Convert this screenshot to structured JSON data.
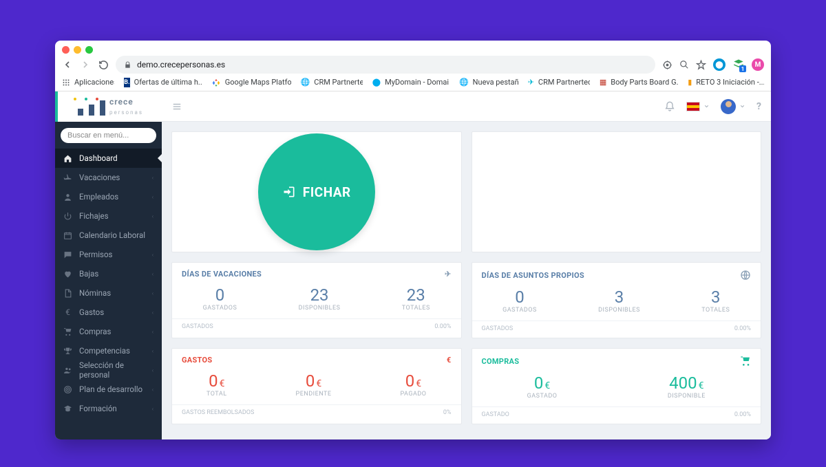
{
  "browser": {
    "url": "demo.crecepersonas.es",
    "bookmarks": [
      "Aplicaciones",
      "Ofertas de última h...",
      "Google Maps Platfo...",
      "CRM Partnertec",
      "MyDomain - Domai...",
      "Nueva pestaña",
      "CRM Partnertec",
      "Body Parts Board G...",
      "RETO 3 Iniciación -..."
    ],
    "avatar_initial": "M"
  },
  "logo": {
    "name_a": "crece",
    "name_b": "personas"
  },
  "sidebar": {
    "search_placeholder": "Buscar en menú...",
    "items": [
      {
        "label": "Dashboard",
        "icon": "home",
        "active": true,
        "chev": false
      },
      {
        "label": "Vacaciones",
        "icon": "plane",
        "active": false,
        "chev": true
      },
      {
        "label": "Empleados",
        "icon": "user",
        "active": false,
        "chev": true
      },
      {
        "label": "Fichajes",
        "icon": "power",
        "active": false,
        "chev": true
      },
      {
        "label": "Calendario Laboral",
        "icon": "calendar",
        "active": false,
        "chev": false
      },
      {
        "label": "Permisos",
        "icon": "chat",
        "active": false,
        "chev": true
      },
      {
        "label": "Bajas",
        "icon": "heart",
        "active": false,
        "chev": true
      },
      {
        "label": "Nóminas",
        "icon": "doc",
        "active": false,
        "chev": true
      },
      {
        "label": "Gastos",
        "icon": "euro",
        "active": false,
        "chev": true
      },
      {
        "label": "Compras",
        "icon": "cart",
        "active": false,
        "chev": true
      },
      {
        "label": "Competencias",
        "icon": "trophy",
        "active": false,
        "chev": true
      },
      {
        "label": "Selección de personal",
        "icon": "users",
        "active": false,
        "chev": true
      },
      {
        "label": "Plan de desarrollo",
        "icon": "target",
        "active": false,
        "chev": true
      },
      {
        "label": "Formación",
        "icon": "grad",
        "active": false,
        "chev": true
      }
    ]
  },
  "fichar_label": "FICHAR",
  "cards": {
    "vac": {
      "title": "DÍAS DE VACACIONES",
      "stats": [
        {
          "num": "0",
          "lbl": "GASTADOS"
        },
        {
          "num": "23",
          "lbl": "DISPONIBLES"
        },
        {
          "num": "23",
          "lbl": "TOTALES"
        }
      ],
      "foot_l": "GASTADOS",
      "foot_r": "0.00%"
    },
    "asuntos": {
      "title": "DÍAS DE ASUNTOS PROPIOS",
      "stats": [
        {
          "num": "0",
          "lbl": "GASTADOS"
        },
        {
          "num": "3",
          "lbl": "DISPONIBLES"
        },
        {
          "num": "3",
          "lbl": "TOTALES"
        }
      ],
      "foot_l": "GASTADOS",
      "foot_r": "0.00%"
    },
    "gastos": {
      "title": "GASTOS",
      "stats": [
        {
          "num": "0",
          "cur": "€",
          "lbl": "TOTAL"
        },
        {
          "num": "0",
          "cur": "€",
          "lbl": "PENDIENTE"
        },
        {
          "num": "0",
          "cur": "€",
          "lbl": "PAGADO"
        }
      ],
      "foot_l": "GASTOS REEMBOLSADOS",
      "foot_r": "0%"
    },
    "compras": {
      "title": "COMPRAS",
      "stats": [
        {
          "num": "0",
          "cur": "€",
          "lbl": "GASTADO"
        },
        {
          "num": "400",
          "cur": "€",
          "lbl": "DISPONIBLE"
        }
      ],
      "foot_l": "GASTADO",
      "foot_r": "0.00%"
    }
  }
}
